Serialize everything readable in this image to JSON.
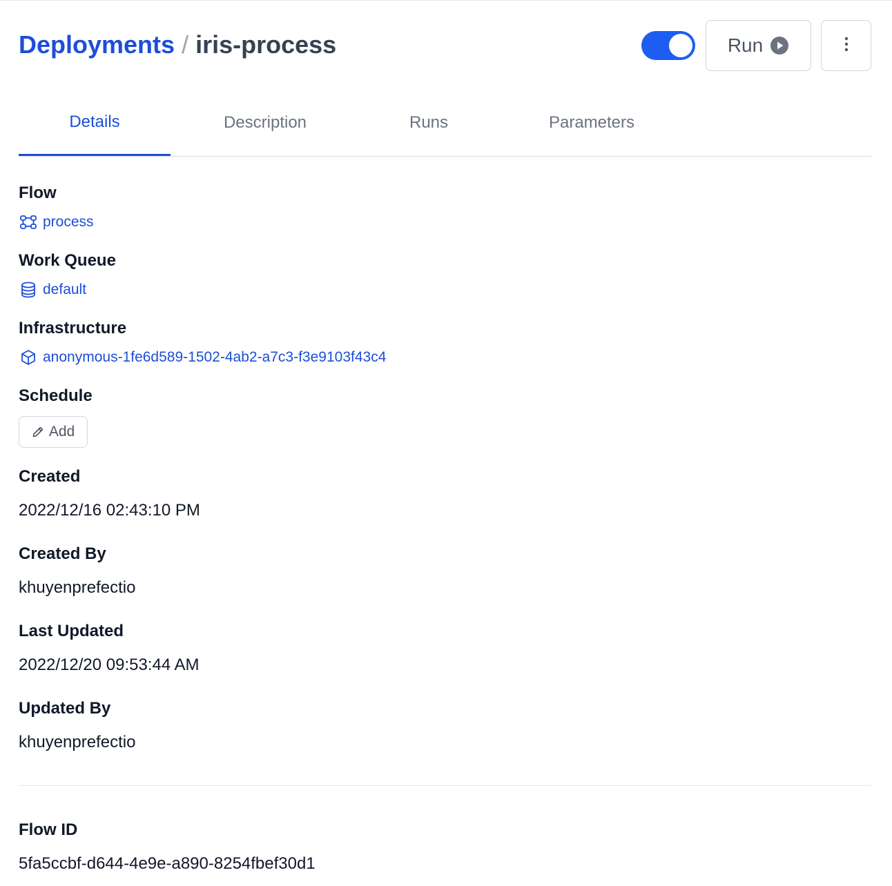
{
  "header": {
    "breadcrumb_root": "Deployments",
    "separator": "/",
    "deployment_name": "iris-process",
    "toggle_state": "on",
    "run_label": "Run",
    "menu_icon": "kebab-menu-icon"
  },
  "tabs": [
    {
      "label": "Details",
      "active": true
    },
    {
      "label": "Description",
      "active": false
    },
    {
      "label": "Runs",
      "active": false
    },
    {
      "label": "Parameters",
      "active": false
    }
  ],
  "details": {
    "flow": {
      "label": "Flow",
      "value": "process",
      "icon": "flow-icon"
    },
    "work_queue": {
      "label": "Work Queue",
      "value": "default",
      "icon": "database-icon"
    },
    "infrastructure": {
      "label": "Infrastructure",
      "value": "anonymous-1fe6d589-1502-4ab2-a7c3-f3e9103f43c4",
      "icon": "cube-icon"
    },
    "schedule": {
      "label": "Schedule",
      "add_label": "Add",
      "icon": "pencil-icon"
    },
    "created": {
      "label": "Created",
      "value": "2022/12/16 02:43:10 PM"
    },
    "created_by": {
      "label": "Created By",
      "value": "khuyenprefectio"
    },
    "last_updated": {
      "label": "Last Updated",
      "value": "2022/12/20 09:53:44 AM"
    },
    "updated_by": {
      "label": "Updated By",
      "value": "khuyenprefectio"
    },
    "flow_id": {
      "label": "Flow ID",
      "value": "5fa5ccbf-d644-4e9e-a890-8254fbef30d1"
    }
  },
  "colors": {
    "accent": "#1d4ed8",
    "toggle": "#1d5df2",
    "muted_text": "#6b7280",
    "border": "#d1d5db"
  }
}
